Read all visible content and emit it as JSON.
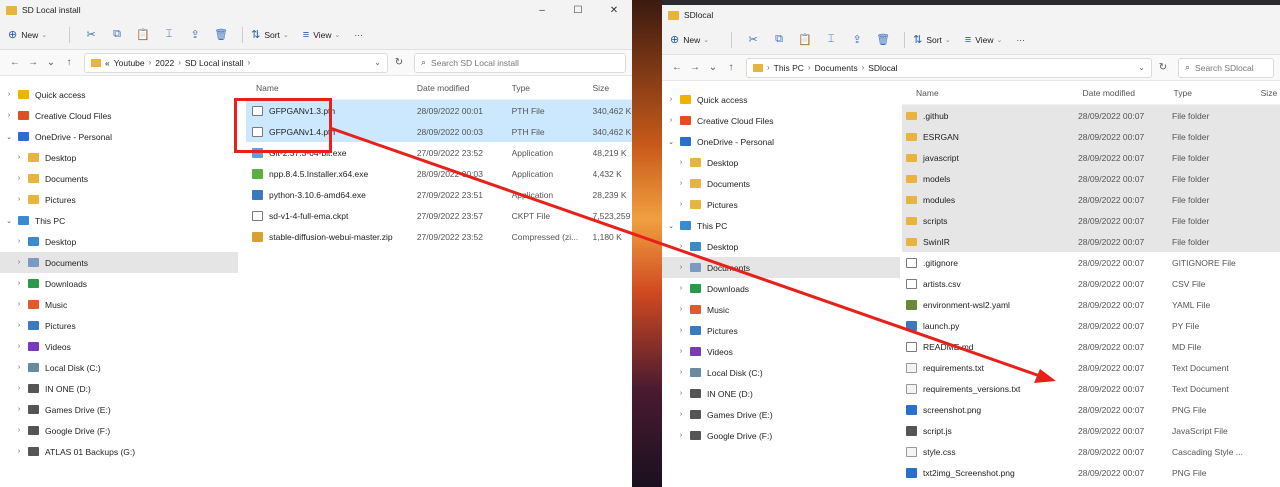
{
  "colors": {
    "accent": "#e8201a",
    "selection": "#cce8ff",
    "folder": "#e8b440"
  },
  "win1": {
    "title": "SD Local install",
    "controls": [
      "–",
      "☐",
      "✕"
    ],
    "cmd": {
      "new": "New",
      "sort": "Sort",
      "view": "View",
      "more": "···"
    },
    "breadcrumb": [
      "«",
      "Youtube",
      "2022",
      "SD Local install"
    ],
    "search_placeholder": "Search SD Local install",
    "nav": [
      {
        "label": "Quick access",
        "icon": "star-icon",
        "color": "#f0b400",
        "exp": "›",
        "indent": 0
      },
      {
        "label": "Creative Cloud Files",
        "icon": "creative-cloud-icon",
        "color": "#e05020",
        "exp": "›",
        "indent": 0
      },
      {
        "label": "OneDrive - Personal",
        "icon": "cloud-icon",
        "color": "#2a6fd0",
        "exp": "⌄",
        "indent": 0
      },
      {
        "label": "Desktop",
        "icon": "folder-icon",
        "color": "#e8b440",
        "exp": "›",
        "indent": 1
      },
      {
        "label": "Documents",
        "icon": "folder-icon",
        "color": "#e8b440",
        "exp": "›",
        "indent": 1
      },
      {
        "label": "Pictures",
        "icon": "folder-icon",
        "color": "#e8b440",
        "exp": "›",
        "indent": 1
      },
      {
        "label": "This PC",
        "icon": "computer-icon",
        "color": "#3a8ad0",
        "exp": "⌄",
        "indent": 0
      },
      {
        "label": "Desktop",
        "icon": "desktop-icon",
        "color": "#3a8ad0",
        "exp": "›",
        "indent": 1
      },
      {
        "label": "Documents",
        "icon": "documents-icon",
        "color": "#7a9ac0",
        "exp": "›",
        "indent": 1,
        "selected": true
      },
      {
        "label": "Downloads",
        "icon": "download-icon",
        "color": "#2a9a4a",
        "exp": "›",
        "indent": 1
      },
      {
        "label": "Music",
        "icon": "music-icon",
        "color": "#e05a2a",
        "exp": "›",
        "indent": 1
      },
      {
        "label": "Pictures",
        "icon": "pictures-icon",
        "color": "#3a7ac0",
        "exp": "›",
        "indent": 1
      },
      {
        "label": "Videos",
        "icon": "videos-icon",
        "color": "#7a3ac0",
        "exp": "›",
        "indent": 1
      },
      {
        "label": "Local Disk (C:)",
        "icon": "drive-icon",
        "color": "#6a8aa0",
        "exp": "›",
        "indent": 1
      },
      {
        "label": "IN ONE (D:)",
        "icon": "drive-icon",
        "color": "#555",
        "exp": "›",
        "indent": 1
      },
      {
        "label": "Games Drive (E:)",
        "icon": "drive-icon",
        "color": "#555",
        "exp": "›",
        "indent": 1
      },
      {
        "label": "Google Drive (F:)",
        "icon": "drive-icon",
        "color": "#555",
        "exp": "›",
        "indent": 1
      },
      {
        "label": "ATLAS 01 Backups (G:)",
        "icon": "drive-icon",
        "color": "#555",
        "exp": "›",
        "indent": 1
      }
    ],
    "columns": [
      "Name",
      "Date modified",
      "Type",
      "Size"
    ],
    "files": [
      {
        "name": "GFPGANv1.3.pth",
        "date": "28/09/2022 00:01",
        "type": "PTH File",
        "size": "340,462 K",
        "icon": "doc",
        "selected": true
      },
      {
        "name": "GFPGANv1.4.pth",
        "date": "28/09/2022 00:03",
        "type": "PTH File",
        "size": "340,462 K",
        "icon": "doc",
        "selected": true
      },
      {
        "name": "Git-2.37.3-64-bit.exe",
        "date": "27/09/2022 23:52",
        "type": "Application",
        "size": "48,219 K",
        "icon": "exe"
      },
      {
        "name": "npp.8.4.5.Installer.x64.exe",
        "date": "28/09/2022 00:03",
        "type": "Application",
        "size": "4,432 K",
        "icon": "npp"
      },
      {
        "name": "python-3.10.6-amd64.exe",
        "date": "27/09/2022 23:51",
        "type": "Application",
        "size": "28,239 K",
        "icon": "py"
      },
      {
        "name": "sd-v1-4-full-ema.ckpt",
        "date": "27/09/2022 23:57",
        "type": "CKPT File",
        "size": "7,523,259",
        "icon": "doc"
      },
      {
        "name": "stable-diffusion-webui-master.zip",
        "date": "27/09/2022 23:52",
        "type": "Compressed (zi...",
        "size": "1,180 K",
        "icon": "zip"
      }
    ]
  },
  "win2": {
    "title": "SDlocal",
    "cmd": {
      "new": "New",
      "sort": "Sort",
      "view": "View",
      "more": "···"
    },
    "breadcrumb": [
      "This PC",
      "Documents",
      "SDlocal"
    ],
    "search_placeholder": "Search SDlocal",
    "nav": [
      {
        "label": "Quick access",
        "icon": "star-icon",
        "color": "#f0b400",
        "exp": "›",
        "indent": 0
      },
      {
        "label": "Creative Cloud Files",
        "icon": "creative-cloud-icon",
        "color": "#e05020",
        "exp": "›",
        "indent": 0
      },
      {
        "label": "OneDrive - Personal",
        "icon": "cloud-icon",
        "color": "#2a6fd0",
        "exp": "⌄",
        "indent": 0
      },
      {
        "label": "Desktop",
        "icon": "folder-icon",
        "color": "#e8b440",
        "exp": "›",
        "indent": 1
      },
      {
        "label": "Documents",
        "icon": "folder-icon",
        "color": "#e8b440",
        "exp": "›",
        "indent": 1
      },
      {
        "label": "Pictures",
        "icon": "folder-icon",
        "color": "#e8b440",
        "exp": "›",
        "indent": 1
      },
      {
        "label": "This PC",
        "icon": "computer-icon",
        "color": "#3a8ad0",
        "exp": "⌄",
        "indent": 0
      },
      {
        "label": "Desktop",
        "icon": "desktop-icon",
        "color": "#3a8ad0",
        "exp": "›",
        "indent": 1
      },
      {
        "label": "Documents",
        "icon": "documents-icon",
        "color": "#7a9ac0",
        "exp": "›",
        "indent": 1,
        "selected": true
      },
      {
        "label": "Downloads",
        "icon": "download-icon",
        "color": "#2a9a4a",
        "exp": "›",
        "indent": 1
      },
      {
        "label": "Music",
        "icon": "music-icon",
        "color": "#e05a2a",
        "exp": "›",
        "indent": 1
      },
      {
        "label": "Pictures",
        "icon": "pictures-icon",
        "color": "#3a7ac0",
        "exp": "›",
        "indent": 1
      },
      {
        "label": "Videos",
        "icon": "videos-icon",
        "color": "#7a3ac0",
        "exp": "›",
        "indent": 1
      },
      {
        "label": "Local Disk (C:)",
        "icon": "drive-icon",
        "color": "#6a8aa0",
        "exp": "›",
        "indent": 1
      },
      {
        "label": "IN ONE (D:)",
        "icon": "drive-icon",
        "color": "#555",
        "exp": "›",
        "indent": 1
      },
      {
        "label": "Games Drive (E:)",
        "icon": "drive-icon",
        "color": "#555",
        "exp": "›",
        "indent": 1
      },
      {
        "label": "Google Drive (F:)",
        "icon": "drive-icon",
        "color": "#555",
        "exp": "›",
        "indent": 1
      }
    ],
    "columns": [
      "Name",
      "Date modified",
      "Type",
      "Size"
    ],
    "files": [
      {
        "name": ".github",
        "date": "28/09/2022 00:07",
        "type": "File folder",
        "icon": "folder"
      },
      {
        "name": "ESRGAN",
        "date": "28/09/2022 00:07",
        "type": "File folder",
        "icon": "folder"
      },
      {
        "name": "javascript",
        "date": "28/09/2022 00:07",
        "type": "File folder",
        "icon": "folder"
      },
      {
        "name": "models",
        "date": "28/09/2022 00:07",
        "type": "File folder",
        "icon": "folder"
      },
      {
        "name": "modules",
        "date": "28/09/2022 00:07",
        "type": "File folder",
        "icon": "folder"
      },
      {
        "name": "scripts",
        "date": "28/09/2022 00:07",
        "type": "File folder",
        "icon": "folder"
      },
      {
        "name": "SwinIR",
        "date": "28/09/2022 00:07",
        "type": "File folder",
        "icon": "folder"
      },
      {
        "name": ".gitignore",
        "date": "28/09/2022 00:07",
        "type": "GITIGNORE File",
        "icon": "doc"
      },
      {
        "name": "artists.csv",
        "date": "28/09/2022 00:07",
        "type": "CSV File",
        "icon": "doc"
      },
      {
        "name": "environment-wsl2.yaml",
        "date": "28/09/2022 00:07",
        "type": "YAML File",
        "icon": "yaml"
      },
      {
        "name": "launch.py",
        "date": "28/09/2022 00:07",
        "type": "PY File",
        "icon": "py"
      },
      {
        "name": "README.md",
        "date": "28/09/2022 00:07",
        "type": "MD File",
        "icon": "doc"
      },
      {
        "name": "requirements.txt",
        "date": "28/09/2022 00:07",
        "type": "Text Document",
        "icon": "txt"
      },
      {
        "name": "requirements_versions.txt",
        "date": "28/09/2022 00:07",
        "type": "Text Document",
        "icon": "txt"
      },
      {
        "name": "screenshot.png",
        "date": "28/09/2022 00:07",
        "type": "PNG File",
        "icon": "img"
      },
      {
        "name": "script.js",
        "date": "28/09/2022 00:07",
        "type": "JavaScript File",
        "icon": "js"
      },
      {
        "name": "style.css",
        "date": "28/09/2022 00:07",
        "type": "Cascading Style ...",
        "icon": "txt"
      },
      {
        "name": "txt2img_Screenshot.png",
        "date": "28/09/2022 00:07",
        "type": "PNG File",
        "icon": "img"
      }
    ]
  }
}
